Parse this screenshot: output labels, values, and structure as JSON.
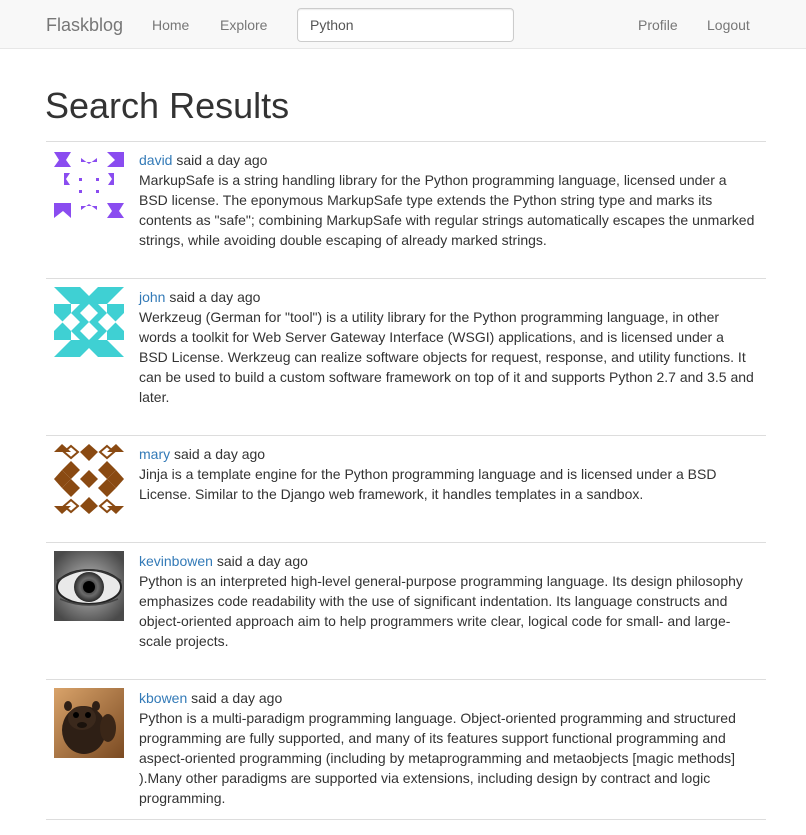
{
  "navbar": {
    "brand": "Flaskblog",
    "home": "Home",
    "explore": "Explore",
    "search_value": "Python",
    "profile": "Profile",
    "logout": "Logout"
  },
  "page": {
    "title": "Search Results"
  },
  "posts": [
    {
      "author": "david",
      "meta": " said a day ago",
      "body": "MarkupSafe is a string handling library for the Python programming language, licensed under a BSD license. The eponymous MarkupSafe type extends the Python string type and marks its contents as \"safe\"; combining MarkupSafe with regular strings automatically escapes the unmarked strings, while avoiding double escaping of already marked strings.",
      "avatar": "identicon-purple"
    },
    {
      "author": "john",
      "meta": " said a day ago",
      "body": "Werkzeug (German for \"tool\") is a utility library for the Python programming language, in other words a toolkit for Web Server Gateway Interface (WSGI) applications, and is licensed under a BSD License. Werkzeug can realize software objects for request, response, and utility functions. It can be used to build a custom software framework on top of it and supports Python 2.7 and 3.5 and later.",
      "avatar": "identicon-teal"
    },
    {
      "author": "mary",
      "meta": " said a day ago",
      "body": "Jinja is a template engine for the Python programming language and is licensed under a BSD License. Similar to the Django web framework, it handles templates in a sandbox.",
      "avatar": "identicon-brown"
    },
    {
      "author": "kevinbowen",
      "meta": " said a day ago",
      "body": "Python is an interpreted high-level general-purpose programming language. Its design philosophy emphasizes code readability with the use of significant indentation. Its language constructs and object-oriented approach aim to help programmers write clear, logical code for small- and large-scale projects.",
      "avatar": "photo-eye"
    },
    {
      "author": "kbowen",
      "meta": " said a day ago",
      "body": "Python is a multi-paradigm programming language. Object-oriented programming and structured programming are fully supported, and many of its features support functional programming and aspect-oriented programming (including by metaprogramming and metaobjects [magic methods] ).Many other paradigms are supported via extensions, including design by contract and logic programming.",
      "avatar": "photo-animal"
    }
  ],
  "colors": {
    "link": "#337ab7",
    "navbar_bg": "#f8f8f8",
    "nav_text": "#777777",
    "purple": "#8a4cf0",
    "teal": "#3fd0d3",
    "brown": "#8a4a12"
  }
}
